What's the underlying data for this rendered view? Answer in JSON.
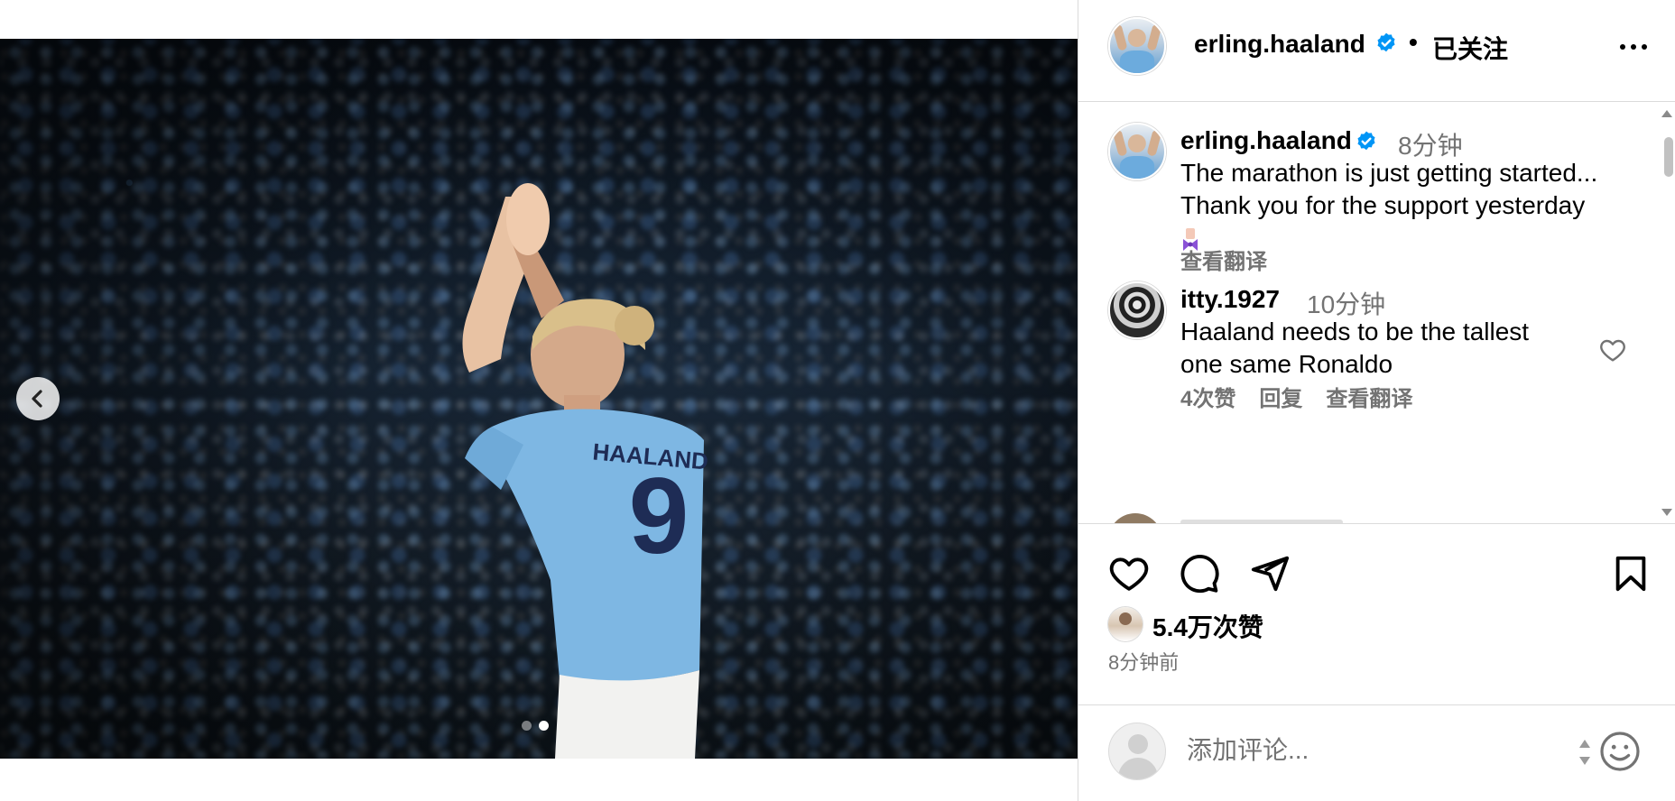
{
  "post": {
    "image_alt": "",
    "carousel": {
      "total": 2,
      "active_index": 1
    }
  },
  "header": {
    "username": "erling.haaland",
    "separator": "•",
    "follow_status": "已关注"
  },
  "caption": {
    "username": "erling.haaland",
    "time": "8分钟",
    "text_line1": "The marathon is just getting started...",
    "text_line2": "Thank you for the support yesterday",
    "see_translation": "查看翻译"
  },
  "comments": [
    {
      "username": "itty.1927",
      "time": "10分钟",
      "text_line1": "Haaland needs to be the tallest",
      "text_line2": "one same Ronaldo",
      "likes": "4次赞",
      "reply": "回复",
      "see_translation": "查看翻译"
    }
  ],
  "actions": {
    "like_icon": "heart-icon",
    "comment_icon": "comment-bubble-icon",
    "share_icon": "paper-plane-icon",
    "save_icon": "bookmark-icon"
  },
  "stats": {
    "likes": "5.4万次赞",
    "posted_ago": "8分钟前"
  },
  "add_comment": {
    "placeholder": "添加评论..."
  },
  "colors": {
    "verified_blue": "#0095f6",
    "muted_text": "#737373",
    "divider": "#dbdbdb",
    "city_blue": "#6cabdd"
  }
}
